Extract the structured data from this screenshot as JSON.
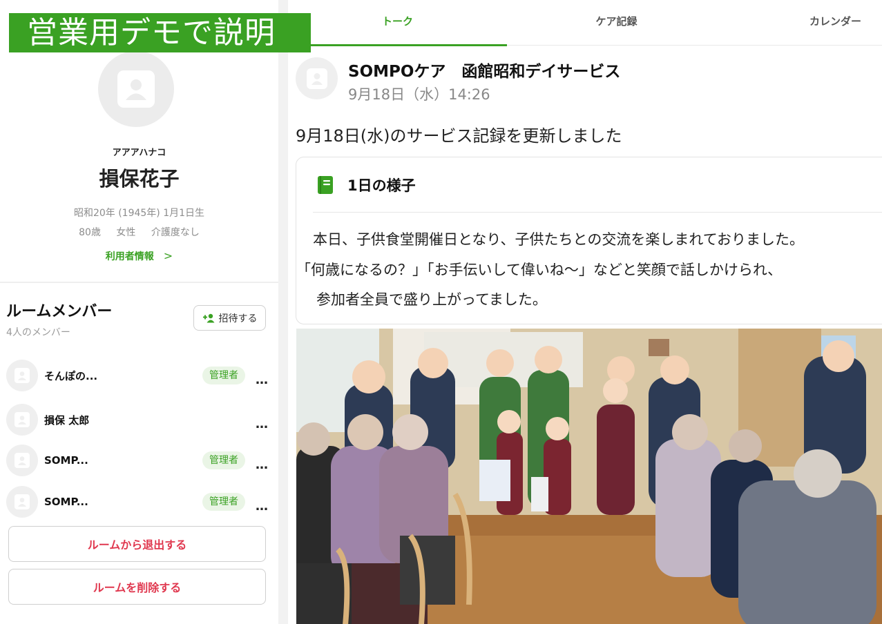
{
  "banner": {
    "text": "営業用デモで説明"
  },
  "profile": {
    "kana": "アアアハナコ",
    "name": "損保花子",
    "birth": "昭和20年 (1945年) 1月1日生",
    "age": "80歳",
    "gender": "女性",
    "care_level": "介護度なし",
    "info_link": "利用者情報",
    "info_chevron": ">"
  },
  "members": {
    "title": "ルームメンバー",
    "count": "4人のメンバー",
    "invite_label": "招待する",
    "more_glyph": "…",
    "items": [
      {
        "name": "そんぽの...",
        "badge": "管理者"
      },
      {
        "name": "損保 太郎",
        "badge": ""
      },
      {
        "name": "SOMP...",
        "badge": "管理者"
      },
      {
        "name": "SOMP...",
        "badge": "管理者"
      }
    ]
  },
  "actions": {
    "leave_room": "ルームから退出する",
    "delete_room": "ルームを削除する"
  },
  "tabs": [
    {
      "label": "トーク",
      "active": true
    },
    {
      "label": "ケア記録",
      "active": false
    },
    {
      "label": "カレンダー",
      "active": false
    }
  ],
  "post": {
    "sender": "SOMPOケア　函館昭和デイサービス",
    "time": "9月18日（水）14:26",
    "message": "9月18日(水)のサービス記録を更新しました",
    "record": {
      "title": "1日の様子",
      "lines": [
        "本日、子供食堂開催日となり、子供たちとの交流を楽しまれておりました。",
        "「何歳になるの？」「お手伝いして偉いね～」などと笑顔で話しかけられ、",
        "参加者全員で盛り上がってました。"
      ]
    }
  },
  "colors": {
    "accent": "#3aa123",
    "danger": "#e0384f",
    "badge_bg": "#eaf5e6"
  }
}
